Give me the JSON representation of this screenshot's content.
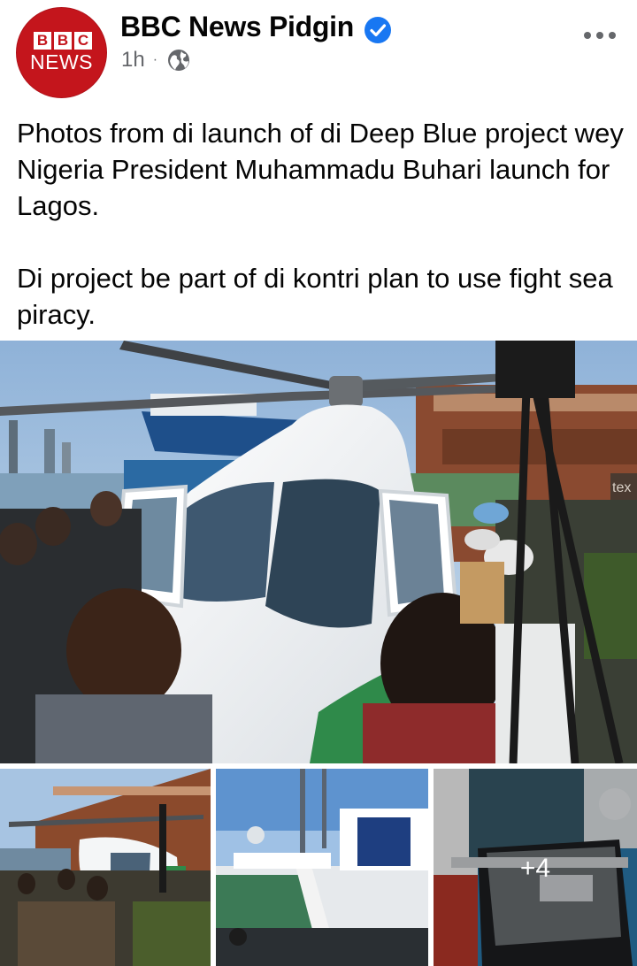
{
  "post": {
    "page_name": "BBC News Pidgin",
    "verified": true,
    "timestamp": "1h",
    "separator": "·",
    "audience_icon": "globe-icon",
    "more_icon": "more-horizontal-icon",
    "avatar": {
      "logo_letters": [
        "B",
        "B",
        "C"
      ],
      "logo_word": "NEWS",
      "brand_color": "#c4151c"
    },
    "text_paragraphs": [
      "Photos from di launch of di Deep Blue project wey Nigeria President Muhammadu Buhari launch for Lagos.",
      "Di project be part of di kontri plan to use fight sea piracy."
    ]
  },
  "photos": {
    "main": {
      "description": "helicopter",
      "container_text": "tex"
    },
    "thumbnails": [
      {
        "description": "helicopter-crowd"
      },
      {
        "description": "ship"
      },
      {
        "description": "equipment-case",
        "more_overlay": "+4"
      }
    ]
  },
  "colors": {
    "verified_blue": "#1877f2",
    "meta_grey": "#65676b"
  }
}
